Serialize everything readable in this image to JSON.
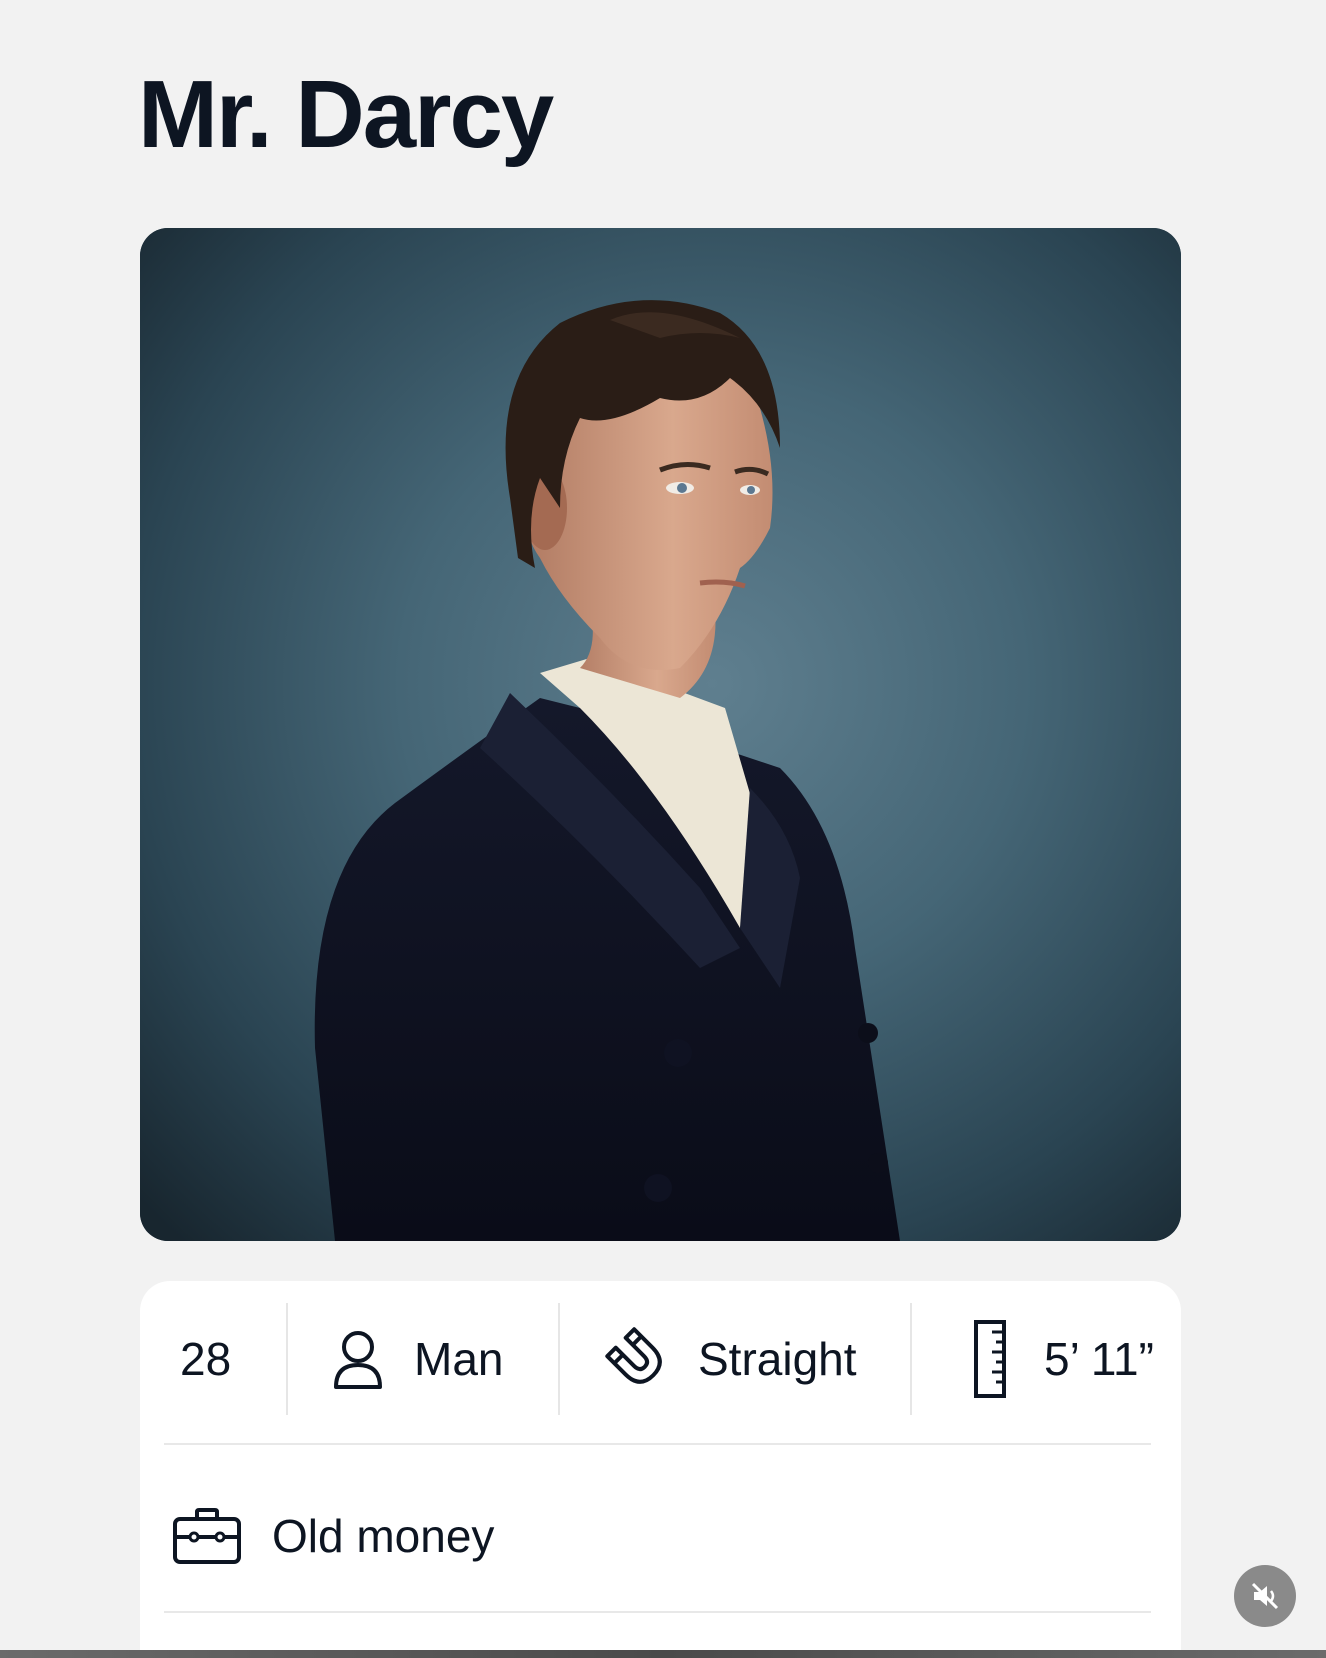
{
  "profile": {
    "name": "Mr. Darcy",
    "photo_alt": "Profile photo"
  },
  "stats": {
    "age": "28",
    "gender": {
      "label": "Man",
      "icon": "person-icon"
    },
    "orientation": {
      "label": "Straight",
      "icon": "magnet-icon"
    },
    "height": {
      "label": "5’ 11”",
      "icon": "ruler-icon"
    }
  },
  "job": {
    "label": "Old money",
    "icon": "briefcase-icon"
  },
  "controls": {
    "mute_icon": "speaker-muted-icon"
  },
  "colors": {
    "background": "#f2f2f2",
    "card": "#ffffff",
    "text": "#0d1522",
    "photo_bg": "#48697a",
    "mute_button": "#8a8a8a"
  }
}
